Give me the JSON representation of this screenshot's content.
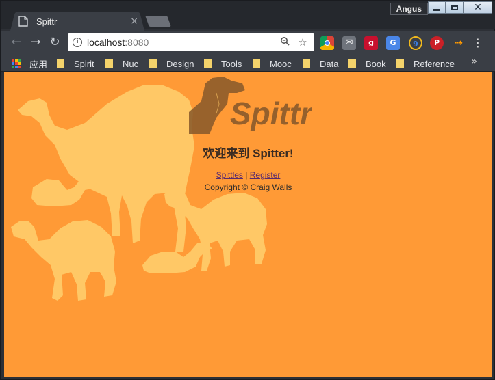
{
  "window": {
    "user": "Angus",
    "controls": {
      "minimize": "",
      "maximize": "",
      "close": "✕"
    }
  },
  "tab": {
    "title": "Spittr",
    "close": "×"
  },
  "toolbar": {
    "back": "←",
    "forward": "→",
    "reload": "↻",
    "url_host": "localhost",
    "url_port": ":8080",
    "info": "i",
    "zoom": "⚲",
    "star": "☆",
    "menu": "⋮"
  },
  "extensions": [
    {
      "name": "chrome-webstore-icon",
      "color": "#dd4b39",
      "glyph": ""
    },
    {
      "name": "mail-icon",
      "color": "#777c84",
      "glyph": "✉"
    },
    {
      "name": "extension-red-icon",
      "color": "#c8102e",
      "glyph": "g"
    },
    {
      "name": "google-translate-icon",
      "color": "#4a86e8",
      "glyph": "G"
    },
    {
      "name": "checker-icon",
      "color": "#2d6cdf",
      "glyph": "9"
    },
    {
      "name": "pinterest-icon",
      "color": "#cb2027",
      "glyph": "P"
    },
    {
      "name": "amazon-icon",
      "color": "#3a3e45",
      "glyph": "→"
    }
  ],
  "bookmarks": {
    "apps_label": "应用",
    "items": [
      "Spirit",
      "Nuc",
      "Design",
      "Tools",
      "Mooc",
      "Data",
      "Book",
      "Reference"
    ],
    "more": "»"
  },
  "page": {
    "logo_text": "Spittr",
    "welcome": "欢迎来到 Spitter!",
    "link_spittles": "Spittles",
    "separator": " | ",
    "link_register": "Register",
    "copyright": "Copyright © Craig Walls"
  },
  "colors": {
    "page_bg": "#ff9a36",
    "camel": "#ffc866",
    "logo_brown": "#8a5a2b"
  }
}
